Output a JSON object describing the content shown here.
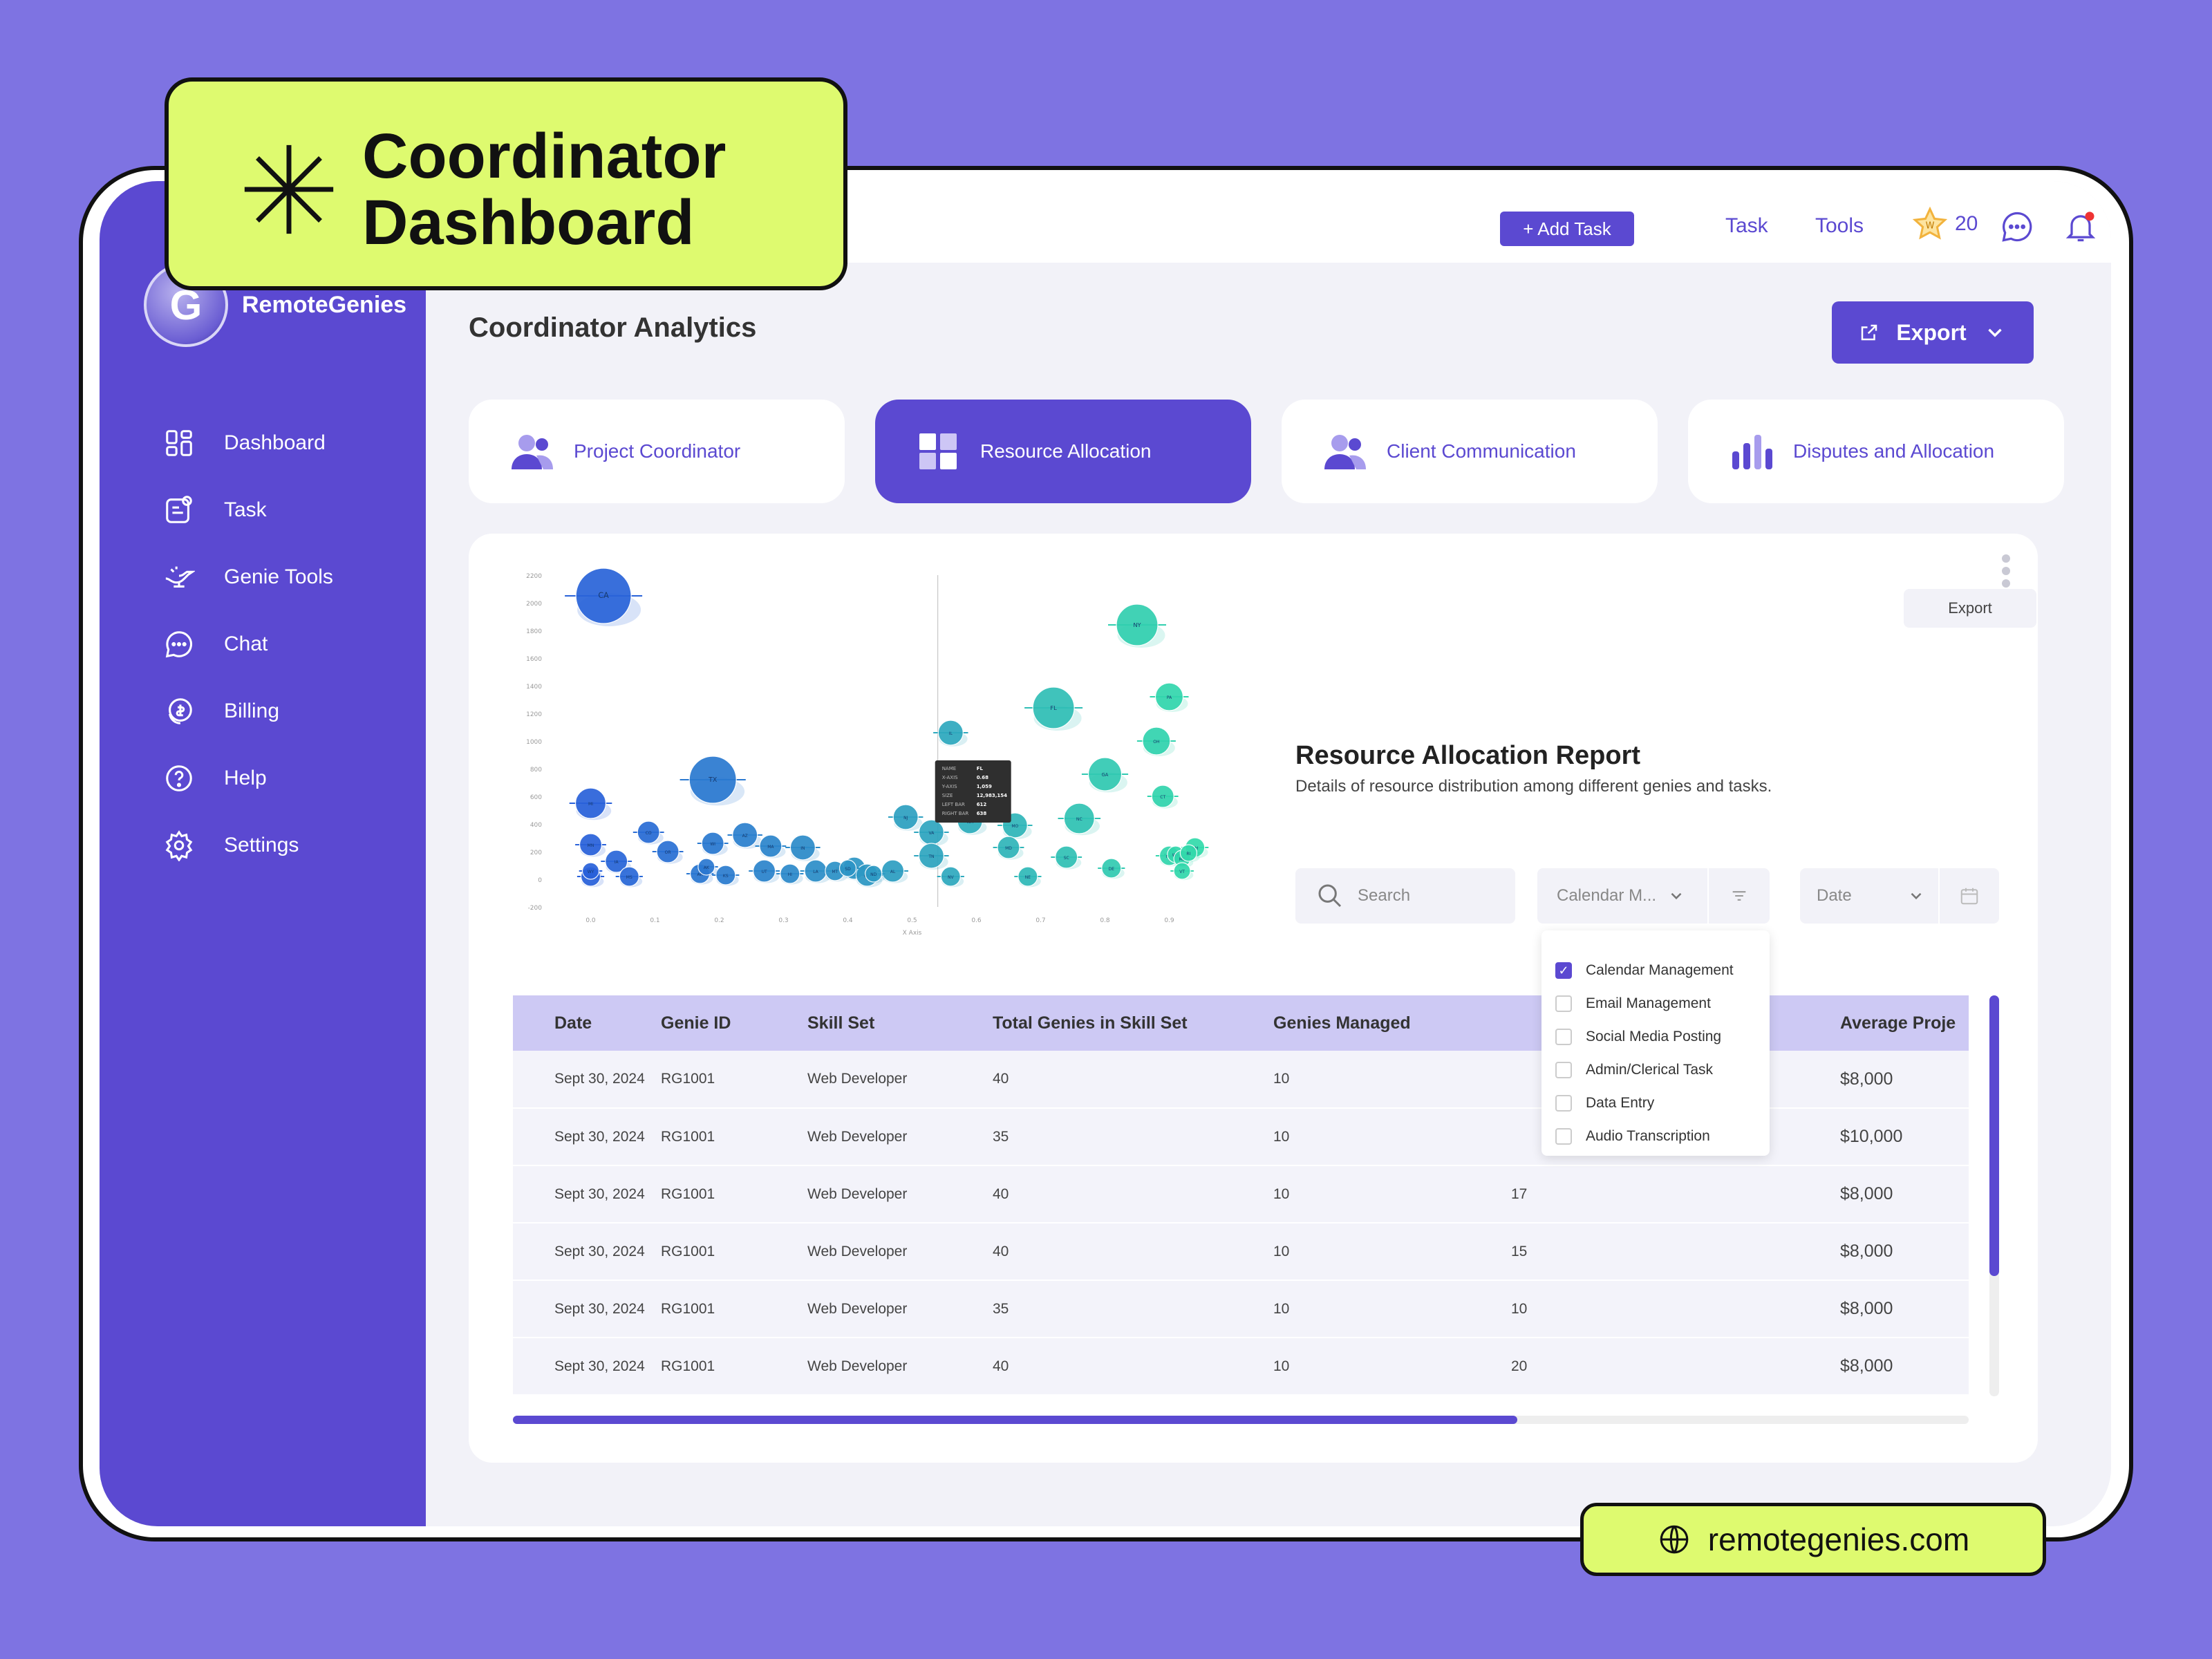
{
  "badge": {
    "title_line1": "Coordinator",
    "title_line2": "Dashboard"
  },
  "url_pill": {
    "text": "remotegenies.com"
  },
  "brand": {
    "name": "RemoteGenies",
    "accent": "#5b49d1",
    "highlight": "#defa6f",
    "background": "#7e73e2"
  },
  "sidebar": {
    "items": [
      {
        "label": "Dashboard",
        "icon": "grid-icon"
      },
      {
        "label": "Task",
        "icon": "task-icon"
      },
      {
        "label": "Genie Tools",
        "icon": "lamp-icon"
      },
      {
        "label": "Chat",
        "icon": "chat-icon"
      },
      {
        "label": "Billing",
        "icon": "billing-icon"
      },
      {
        "label": "Help",
        "icon": "help-icon"
      },
      {
        "label": "Settings",
        "icon": "gear-icon"
      }
    ]
  },
  "topbar": {
    "add_task": "+ Add Task",
    "task": "Task",
    "tools": "Tools",
    "points": "20"
  },
  "main": {
    "title": "Coordinator Analytics",
    "export": "Export",
    "tabs": [
      {
        "label": "Project Coordinator",
        "active": false
      },
      {
        "label": "Resource Allocation",
        "active": true
      },
      {
        "label": "Client Communication",
        "active": false
      },
      {
        "label": "Disputes and Allocation",
        "active": false
      }
    ]
  },
  "report": {
    "export": "Export",
    "title": "Resource Allocation Report",
    "subtitle": "Details of resource distribution among different genies and tasks.",
    "search_placeholder": "Search",
    "filter_value": "Calendar M...",
    "date_placeholder": "Date",
    "dropdown": [
      {
        "label": "Calendar Management",
        "checked": true
      },
      {
        "label": "Email Management",
        "checked": false
      },
      {
        "label": "Social Media Posting",
        "checked": false
      },
      {
        "label": "Admin/Clerical Task",
        "checked": false
      },
      {
        "label": "Data Entry",
        "checked": false
      },
      {
        "label": "Audio Transcription",
        "checked": false
      }
    ],
    "columns": [
      "Date",
      "Genie ID",
      "Skill Set",
      "Total  Genies in Skill Set",
      "Genies Managed",
      "",
      "Average Proje"
    ],
    "rows": [
      [
        "Sept 30, 2024",
        "RG1001",
        "Web Developer",
        "40",
        "10",
        "",
        "$8,000"
      ],
      [
        "Sept 30, 2024",
        "RG1001",
        "Web Developer",
        "35",
        "10",
        "",
        "$10,000"
      ],
      [
        "Sept 30, 2024",
        "RG1001",
        "Web Developer",
        "40",
        "10",
        "17",
        "$8,000"
      ],
      [
        "Sept 30, 2024",
        "RG1001",
        "Web Developer",
        "40",
        "10",
        "15",
        "$8,000"
      ],
      [
        "Sept 30, 2024",
        "RG1001",
        "Web Developer",
        "35",
        "10",
        "10",
        "$8,000"
      ],
      [
        "Sept 30, 2024",
        "RG1001",
        "Web Developer",
        "40",
        "10",
        "20",
        "$8,000"
      ]
    ],
    "h_scroll_fraction": 0.69,
    "v_scroll_fraction": 0.7
  },
  "chart_data": {
    "type": "scatter",
    "title": "",
    "xlabel": "X Axis",
    "ylabel": "",
    "x_ticks": [
      "0.0",
      "0.1",
      "0.2",
      "0.3",
      "0.4",
      "0.5",
      "0.6",
      "0.7",
      "0.8",
      "0.9"
    ],
    "y_ticks": [
      "-200",
      "0",
      "200",
      "400",
      "600",
      "800",
      "1000",
      "1200",
      "1400",
      "1600",
      "1800",
      "2000",
      "2200"
    ],
    "xlim": [
      -0.05,
      0.95
    ],
    "ylim": [
      -200,
      2200
    ],
    "points": [
      {
        "label": "CA",
        "x": 0.02,
        "y": 2050,
        "r": 40
      },
      {
        "label": "TX",
        "x": 0.19,
        "y": 720,
        "r": 34
      },
      {
        "label": "NY",
        "x": 0.85,
        "y": 1840,
        "r": 30
      },
      {
        "label": "FL",
        "x": 0.72,
        "y": 1240,
        "r": 30
      },
      {
        "label": "IL",
        "x": 0.56,
        "y": 1060,
        "r": 18
      },
      {
        "label": "PA",
        "x": 0.9,
        "y": 1320,
        "r": 20
      },
      {
        "label": "OH",
        "x": 0.88,
        "y": 1000,
        "r": 20
      },
      {
        "label": "GA",
        "x": 0.8,
        "y": 760,
        "r": 24
      },
      {
        "label": "NC",
        "x": 0.76,
        "y": 440,
        "r": 22
      },
      {
        "label": "MI",
        "x": 0.0,
        "y": 550,
        "r": 22
      },
      {
        "label": "NJ",
        "x": 0.49,
        "y": 450,
        "r": 18
      },
      {
        "label": "VA",
        "x": 0.53,
        "y": 340,
        "r": 18
      },
      {
        "label": "WA",
        "x": 0.59,
        "y": 420,
        "r": 18
      },
      {
        "label": "AZ",
        "x": 0.24,
        "y": 320,
        "r": 18
      },
      {
        "label": "MA",
        "x": 0.28,
        "y": 240,
        "r": 16
      },
      {
        "label": "TN",
        "x": 0.53,
        "y": 170,
        "r": 18
      },
      {
        "label": "IN",
        "x": 0.33,
        "y": 230,
        "r": 18
      },
      {
        "label": "MO",
        "x": 0.66,
        "y": 390,
        "r": 18
      },
      {
        "label": "MD",
        "x": 0.65,
        "y": 230,
        "r": 16
      },
      {
        "label": "WI",
        "x": 0.19,
        "y": 260,
        "r": 16
      },
      {
        "label": "CO",
        "x": 0.09,
        "y": 340,
        "r": 16
      },
      {
        "label": "MN",
        "x": 0.0,
        "y": 250,
        "r": 16
      },
      {
        "label": "SC",
        "x": 0.74,
        "y": 160,
        "r": 16
      },
      {
        "label": "AL",
        "x": 0.47,
        "y": 60,
        "r": 16
      },
      {
        "label": "LA",
        "x": 0.35,
        "y": 60,
        "r": 16
      },
      {
        "label": "KY",
        "x": 0.41,
        "y": 80,
        "r": 16
      },
      {
        "label": "OR",
        "x": 0.12,
        "y": 200,
        "r": 16
      },
      {
        "label": "OK",
        "x": 0.43,
        "y": 30,
        "r": 16
      },
      {
        "label": "CT",
        "x": 0.89,
        "y": 600,
        "r": 16
      },
      {
        "label": "UT",
        "x": 0.27,
        "y": 60,
        "r": 16
      },
      {
        "label": "IA",
        "x": 0.04,
        "y": 130,
        "r": 16
      },
      {
        "label": "NV",
        "x": 0.56,
        "y": 20,
        "r": 14
      },
      {
        "label": "AR",
        "x": 0.17,
        "y": 40,
        "r": 14
      },
      {
        "label": "MS",
        "x": 0.06,
        "y": 20,
        "r": 14
      },
      {
        "label": "KS",
        "x": 0.21,
        "y": 30,
        "r": 14
      },
      {
        "label": "NM",
        "x": 0.9,
        "y": 170,
        "r": 14
      },
      {
        "label": "NE",
        "x": 0.68,
        "y": 20,
        "r": 14
      },
      {
        "label": "WV",
        "x": 0.91,
        "y": 180,
        "r": 12
      },
      {
        "label": "ID",
        "x": 0.0,
        "y": 20,
        "r": 14
      },
      {
        "label": "HI",
        "x": 0.31,
        "y": 40,
        "r": 14
      },
      {
        "label": "NH",
        "x": 0.94,
        "y": 230,
        "r": 14
      },
      {
        "label": "ME",
        "x": 0.92,
        "y": 150,
        "r": 12
      },
      {
        "label": "RI",
        "x": 0.93,
        "y": 190,
        "r": 12
      },
      {
        "label": "MT",
        "x": 0.38,
        "y": 60,
        "r": 14
      },
      {
        "label": "DE",
        "x": 0.81,
        "y": 80,
        "r": 14
      },
      {
        "label": "SD",
        "x": 0.4,
        "y": 80,
        "r": 12
      },
      {
        "label": "ND",
        "x": 0.44,
        "y": 40,
        "r": 12
      },
      {
        "label": "AK",
        "x": 0.18,
        "y": 90,
        "r": 12
      },
      {
        "label": "VT",
        "x": 0.92,
        "y": 60,
        "r": 12
      },
      {
        "label": "WY",
        "x": 0.0,
        "y": 60,
        "r": 12
      }
    ],
    "tooltip": [
      [
        "NAME",
        "FL"
      ],
      [
        "X-AXIS",
        "0.68"
      ],
      [
        "Y-AXIS",
        "1,059"
      ],
      [
        "SIZE",
        "12,983,154"
      ],
      [
        "LEFT BAR",
        "612"
      ],
      [
        "RIGHT BAR",
        "638"
      ]
    ],
    "tooltip_at": {
      "x": 0.54,
      "y": 760
    }
  }
}
